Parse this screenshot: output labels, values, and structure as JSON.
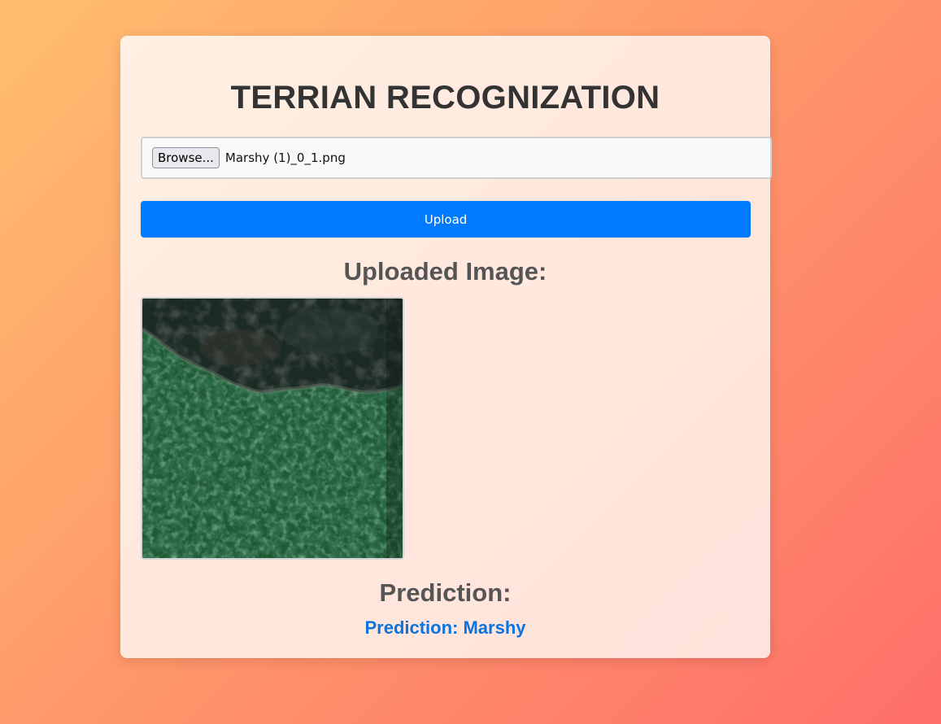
{
  "page": {
    "title": "TERRIAN RECOGNIZATION"
  },
  "upload_form": {
    "browse_label": "Browse...",
    "selected_file": "Marshy (1)_0_1.png",
    "upload_label": "Upload"
  },
  "uploaded_section": {
    "heading": "Uploaded Image:",
    "image_description_icon": "aerial-terrain-image"
  },
  "prediction_section": {
    "heading": "Prediction:",
    "result": "Prediction: Marshy"
  },
  "colors": {
    "accent": "#007bff",
    "prediction": "#0a74e0",
    "title": "#333333",
    "heading": "#555555"
  }
}
